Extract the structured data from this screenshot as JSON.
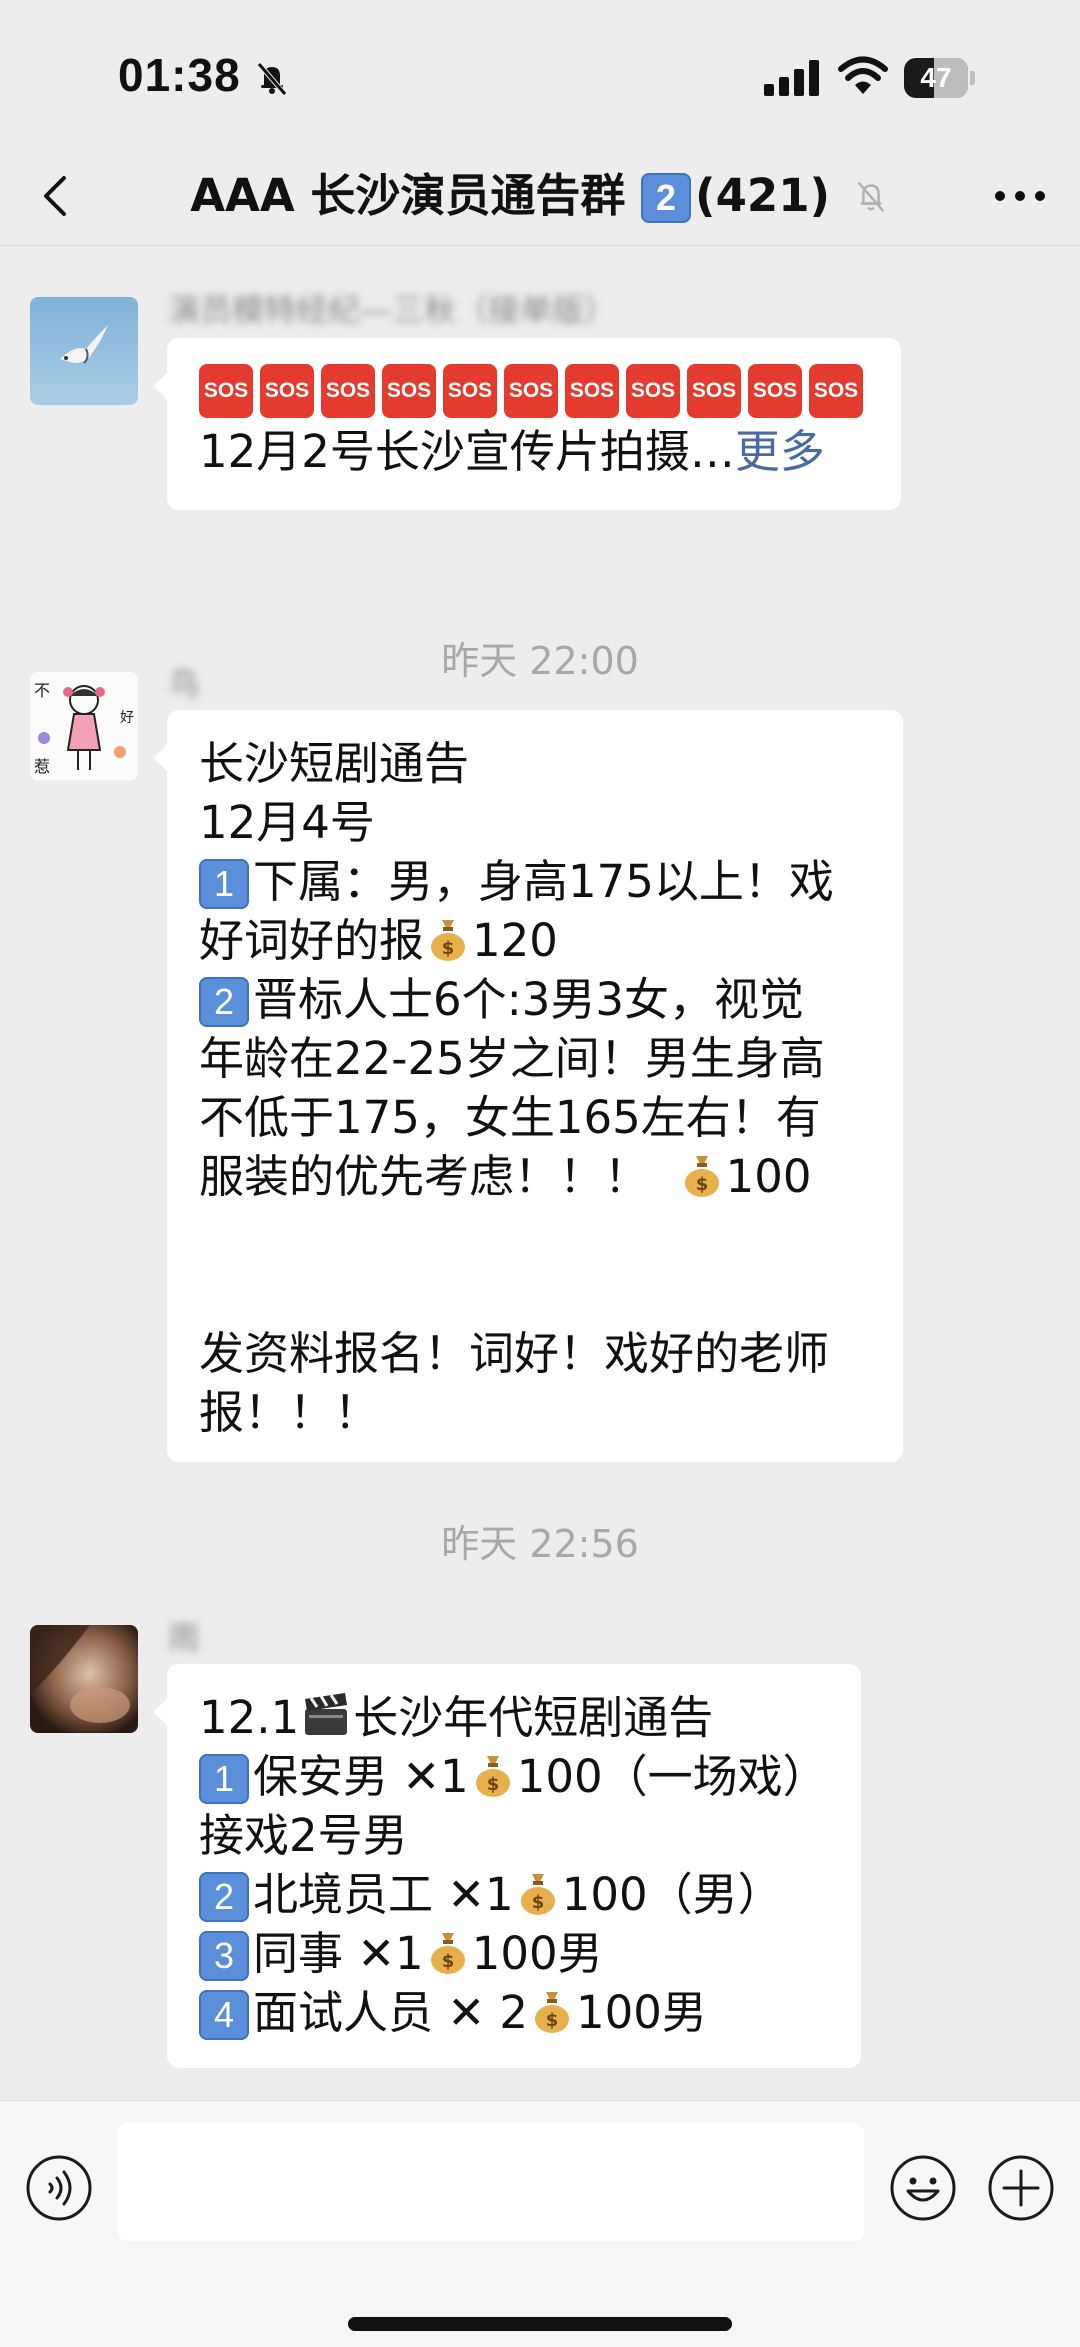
{
  "status_bar": {
    "time": "01:38",
    "battery": "47",
    "battery_level": 0.47
  },
  "header": {
    "title": "AAA 长沙演员通告群",
    "title_badge": "2",
    "member_count": "(421)"
  },
  "messages": [
    {
      "sender": "演员模特经纪—三秋（接单版）",
      "sos_count": 11,
      "sos_label": "SOS",
      "text": "12月2号长沙宣传片拍摄…",
      "more": "更多"
    },
    {
      "time": "昨天 22:00"
    },
    {
      "sender": "鸟",
      "lines": [
        "长沙短剧通告",
        "12月4号",
        "下属：男，身高175以上！戏",
        "好词好的报",
        "晋标人士6个:3男3女，视觉",
        "年龄在22-25岁之间！男生身高",
        "不低于175，女生165左右！有",
        "服装的优先考虑！！！",
        "发资料报名！词好！戏好的老师",
        "报！！！"
      ],
      "badges": [
        "1",
        "2"
      ],
      "prices": [
        "120",
        "100"
      ]
    },
    {
      "time": "昨天 22:56"
    },
    {
      "sender": "雨",
      "lines": [
        "12.1",
        "长沙年代短剧通告",
        "保安男",
        "1",
        "100（一场戏）",
        "接戏2号男",
        "北境员工",
        "1",
        "100（男）",
        "同事",
        "1",
        "100男",
        "面试人员",
        "2",
        "100男"
      ],
      "badges": [
        "1",
        "2",
        "3",
        "4"
      ]
    }
  ],
  "input": {
    "placeholder": ""
  },
  "colors": {
    "background": "#ededed",
    "bubble": "#ffffff",
    "link": "#4a6aa5",
    "sos": "#e43b2e",
    "badge": "#5b8fd9"
  },
  "icons": [
    "back-icon",
    "bell-slash-icon",
    "more-icon",
    "voice-icon",
    "emoji-icon",
    "plus-icon",
    "money-bag-icon",
    "clapperboard-icon"
  ]
}
